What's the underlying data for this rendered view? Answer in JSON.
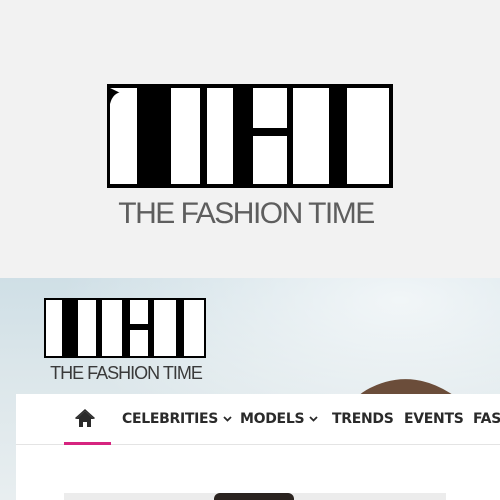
{
  "brand": {
    "logo_letters": "TFT",
    "name": "THE FASHION TIME",
    "colors": {
      "accent": "#d6247f",
      "logo": "#000000",
      "tagline_large": "#5e5e5e",
      "tagline_small": "#3a3a3a"
    }
  },
  "header": {
    "logo_letters": "TFT",
    "name": "THE FASHION TIME"
  },
  "nav": {
    "home_icon": "home-icon",
    "items": [
      {
        "label": "CELEBRITIES",
        "dropdown": true
      },
      {
        "label": "MODELS",
        "dropdown": true
      },
      {
        "label": "TRENDS",
        "dropdown": false
      },
      {
        "label": "EVENTS",
        "dropdown": false
      },
      {
        "label": "FASH",
        "dropdown": false
      }
    ]
  }
}
